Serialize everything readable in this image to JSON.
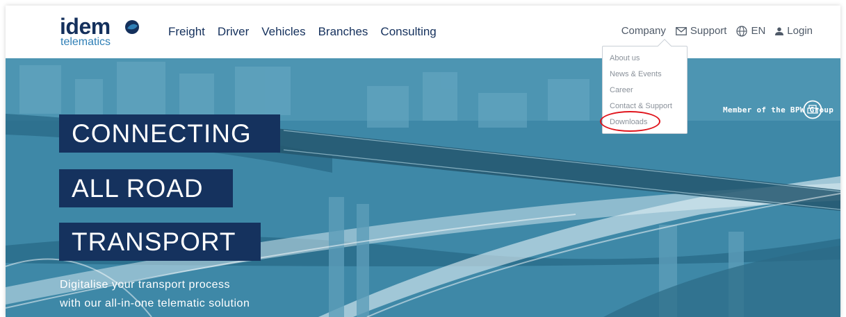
{
  "brand": {
    "name": "idem",
    "sub": "telematics"
  },
  "nav": {
    "main": [
      "Freight",
      "Driver",
      "Vehicles",
      "Branches",
      "Consulting"
    ],
    "company": "Company",
    "support": "Support",
    "language": "EN",
    "login": "Login"
  },
  "dropdown": {
    "items": [
      "About us",
      "News & Events",
      "Career",
      "Contact & Support",
      "Downloads"
    ]
  },
  "hero": {
    "headline": [
      "CONNECTING",
      "ALL ROAD",
      "TRANSPORT"
    ],
    "tagline": [
      "Digitalise your transport process",
      "with our all-in-one telematic solution"
    ],
    "member_text": "Member of the BPW Group",
    "badge_text": "BPW"
  },
  "colors": {
    "navy": "#15325e",
    "logo_blue": "#2f7fb6",
    "highlight": "#e0141c"
  }
}
